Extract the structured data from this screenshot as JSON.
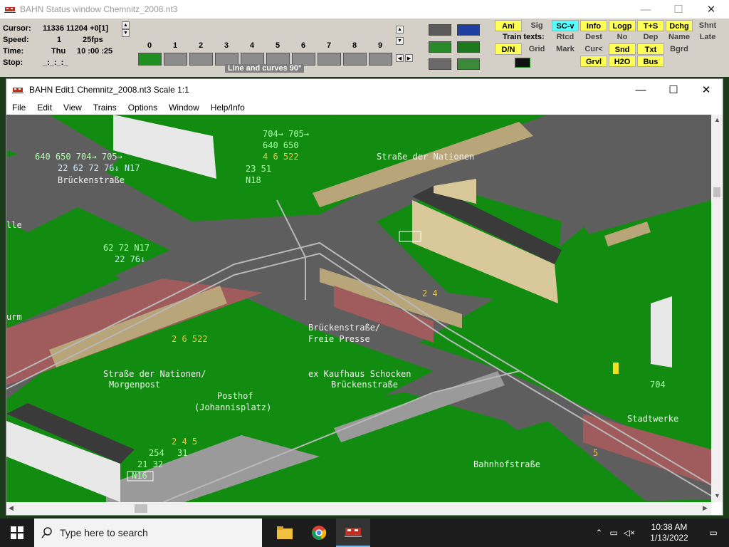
{
  "status_window": {
    "title": "BAHN Status window Chemnitz_2008.nt3",
    "rows": [
      {
        "label": "Cursor:",
        "value": "11336 11204 +0[1]"
      },
      {
        "label": "Speed:",
        "value": "1",
        "value2": "25fps"
      },
      {
        "label": "Time:",
        "value": "Thu",
        "value2": "10 :00 :25"
      },
      {
        "label": "Stop:",
        "value": "_:_:_:_"
      }
    ],
    "track_numbers": [
      "0",
      "1",
      "2",
      "3",
      "4",
      "5",
      "6",
      "7",
      "8",
      "9"
    ],
    "mode_label": "Line and curves 90°",
    "train_texts_label": "Train texts:",
    "buttons": {
      "ani": "Ani",
      "sig": "Sig",
      "scv": "SC-v",
      "info": "Info",
      "logp": "Logp",
      "ts": "T+S",
      "dchg": "Dchg",
      "shnt": "Shnt",
      "rtcd": "Rtcd",
      "dest": "Dest",
      "no": "No",
      "dep": "Dep",
      "name": "Name",
      "late": "Late",
      "dn": "D/N",
      "grid": "Grid",
      "mark": "Mark",
      "cur": "Cur<",
      "snd": "Snd",
      "txt": "Txt",
      "bgrd": "Bgrd",
      "grvl": "Grvl",
      "h2o": "H2O",
      "bus": "Bus"
    }
  },
  "edit_window": {
    "title": "BAHN Edit1 Chemnitz_2008.nt3 Scale 1:1",
    "menu": [
      "File",
      "Edit",
      "View",
      "Trains",
      "Options",
      "Window",
      "Help/Info"
    ]
  },
  "map_labels": [
    {
      "id": "l1",
      "text": "640 650 704→ 705→",
      "cls": "gr"
    },
    {
      "id": "l2",
      "text": "22 62 72 76↓ N17",
      "cls": "cy"
    },
    {
      "id": "l3",
      "text": "Brückenstraße",
      "cls": "wt"
    },
    {
      "id": "l4",
      "text": "704→ 705→",
      "cls": "gr"
    },
    {
      "id": "l5",
      "text": "640 650",
      "cls": "gr"
    },
    {
      "id": "l6",
      "text": "4 6 522",
      "cls": "or"
    },
    {
      "id": "l7",
      "text": "23 51",
      "cls": "gr"
    },
    {
      "id": "l8",
      "text": "N18",
      "cls": "gr"
    },
    {
      "id": "l9",
      "text": "Straße der Nationen",
      "cls": "wt"
    },
    {
      "id": "l10",
      "text": "lle",
      "cls": "wt"
    },
    {
      "id": "l11",
      "text": "62 72 N17",
      "cls": "gr"
    },
    {
      "id": "l12",
      "text": "22 76↓",
      "cls": "cy"
    },
    {
      "id": "l13",
      "text": "urm",
      "cls": "wt"
    },
    {
      "id": "l14",
      "text": "2 4",
      "cls": "or"
    },
    {
      "id": "l15",
      "text": "Brückenstraße/",
      "cls": "wt"
    },
    {
      "id": "l16",
      "text": "Freie Presse",
      "cls": "wt"
    },
    {
      "id": "l17",
      "text": "2 6 522",
      "cls": "or"
    },
    {
      "id": "l18",
      "text": "Straße der Nationen/",
      "cls": "wt"
    },
    {
      "id": "l19",
      "text": "Morgenpost",
      "cls": "wt"
    },
    {
      "id": "l20",
      "text": "ex Kaufhaus Schocken",
      "cls": "wt"
    },
    {
      "id": "l21",
      "text": "Brückenstraße",
      "cls": "wt"
    },
    {
      "id": "l22",
      "text": "Posthof",
      "cls": "wt"
    },
    {
      "id": "l23",
      "text": "(Johannisplatz)",
      "cls": "wt"
    },
    {
      "id": "l24",
      "text": "704",
      "cls": "gr"
    },
    {
      "id": "l25",
      "text": "Stadtwerke",
      "cls": "wt"
    },
    {
      "id": "l26",
      "text": "2 4 5",
      "cls": "or"
    },
    {
      "id": "l27",
      "text": "254",
      "cls": "gr"
    },
    {
      "id": "l28",
      "text": "31",
      "cls": "gr"
    },
    {
      "id": "l29",
      "text": "21 32",
      "cls": "gr"
    },
    {
      "id": "l30",
      "text": "N16",
      "cls": "gr"
    },
    {
      "id": "l31",
      "text": "5",
      "cls": "or"
    },
    {
      "id": "l32",
      "text": "Bahnhofstraße",
      "cls": "wt"
    }
  ],
  "taskbar": {
    "search_placeholder": "Type here to search",
    "time": "10:38 AM",
    "date": "1/13/2022"
  }
}
